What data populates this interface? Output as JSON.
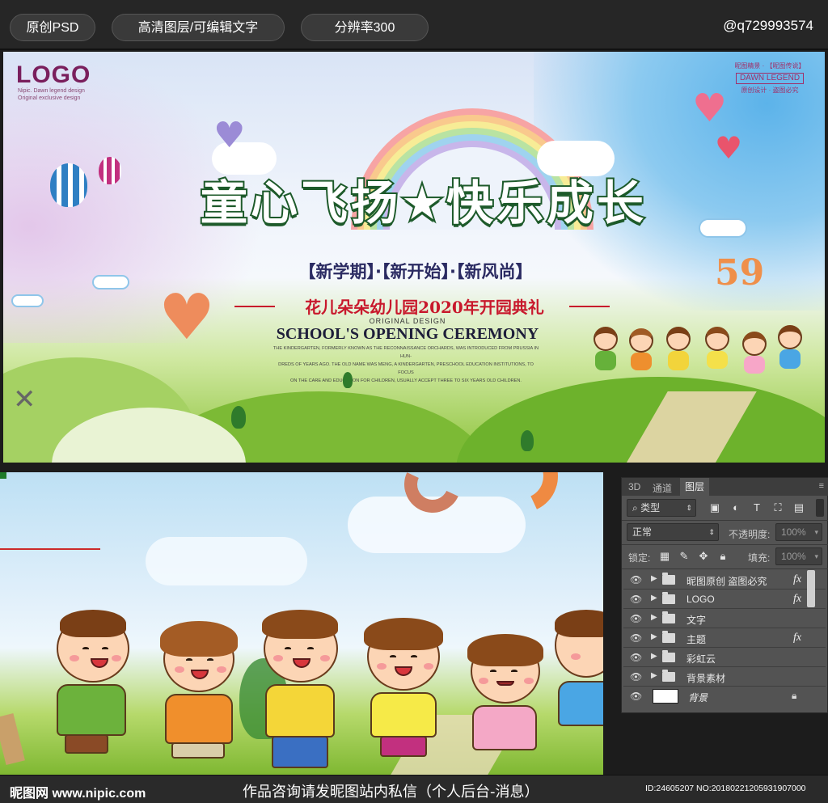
{
  "topbar": {
    "pill1": "原创PSD",
    "pill2": "高清图层/可编辑文字",
    "pill3": "分辨率300",
    "handle": "@q729993574"
  },
  "banner": {
    "logo": "LOGO",
    "logo_sub1": "Nipic. Dawn legend design",
    "logo_sub2": "Original exclusive design",
    "stamp_top": "昵图精景 · 【昵图传说】",
    "stamp_box": "DAWN LEGEND",
    "stamp_bottom": "原创设计 · 盗图必究",
    "headline": "童心飞扬★快乐成长",
    "tagline": "【新学期】·【新开始】·【新风尚】",
    "school": "花儿朵朵幼儿园2020年开园典礼",
    "orig_design": "ORIGINAL DESIGN",
    "ceremony": "SCHOOL'S OPENING CEREMONY",
    "small1": "THE KINDERGARTEN, FORMERLY KNOWN AS THE RECONNAISSANCE ORCHARDS, WAS INTRODUCED FROM PRUSSIA IN HUN-",
    "small2": "DREDS OF YEARS AGO. THE OLD NAME WAS MENG, A KINDERGARTEN, PRESCHOOL EDUCATION INSTITUTIONS, TO FOCUS",
    "small3": "ON THE CARE AND EDUCATION FOR CHILDREN, USUALLY ACCEPT THREE TO SIX YEARS OLD CHILDREN.",
    "number": "59"
  },
  "layers_panel": {
    "tabs": [
      "3D",
      "通道",
      "图层"
    ],
    "filter_label": "类型",
    "blend_mode": "正常",
    "opacity_label": "不透明度:",
    "opacity_value": "100%",
    "lock_label": "锁定:",
    "fill_label": "填充:",
    "fill_value": "100%",
    "layers": [
      {
        "name": "昵图原创 盗图必究",
        "fx": "fx"
      },
      {
        "name": "LOGO",
        "fx": "fx"
      },
      {
        "name": "文字",
        "fx": ""
      },
      {
        "name": "主题",
        "fx": "fx"
      },
      {
        "name": "彩虹云",
        "fx": ""
      },
      {
        "name": "背景素材",
        "fx": ""
      }
    ],
    "background_layer": "背景"
  },
  "footer": {
    "site": "昵图网 www.nipic.com",
    "message": "作品咨询请发昵图站内私信（个人后台-消息）",
    "id": "ID:24605207 NO:20180221205931907000"
  },
  "colors": {
    "headline_stroke": "#1d5a2a",
    "school_red": "#c8182c",
    "logo_purple": "#7a1f5d"
  }
}
